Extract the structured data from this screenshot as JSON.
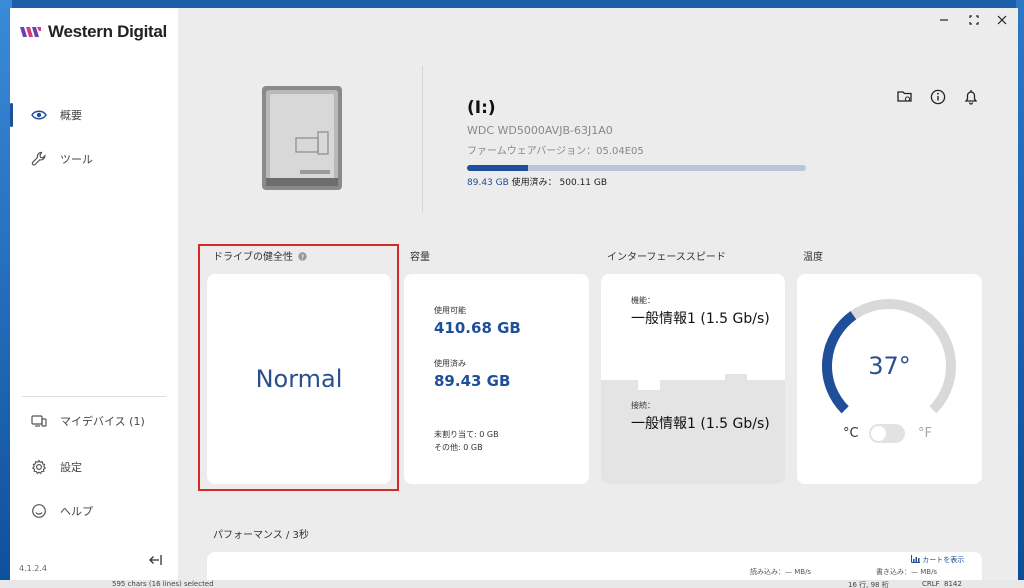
{
  "app": {
    "brand": "Western Digital",
    "version": "4.1.2.4"
  },
  "sidebar": {
    "items": [
      {
        "label": "概要",
        "icon": "eye-icon",
        "active": true
      },
      {
        "label": "ツール",
        "icon": "wrench-icon",
        "active": false
      },
      {
        "label": "マイデバイス (1)",
        "icon": "devices-icon",
        "active": false
      },
      {
        "label": "設定",
        "icon": "gear-icon",
        "active": false
      },
      {
        "label": "ヘルプ",
        "icon": "help-icon",
        "active": false
      }
    ]
  },
  "drive": {
    "title": "(I:)",
    "model": "WDC WD5000AVJB-63J1A0",
    "firmware": "ファームウェアバージョン：05.04E05",
    "used_value": "89.43 GB",
    "used_text": "使用済み：",
    "total": "500.11 GB",
    "used_fraction": 0.179
  },
  "sections": {
    "health": "ドライブの健全性",
    "capacity": "容量",
    "interface": "インターフェーススピード",
    "temperature": "温度",
    "performance": "パフォーマンス / 3秒"
  },
  "health": {
    "value": "Normal"
  },
  "capacity": {
    "available_label": "使用可能",
    "available_value": "410.68 GB",
    "used_label": "使用済み",
    "used_value": "89.43 GB",
    "unallocated": "未割り当て: 0 GB",
    "other": "その他: 0 GB"
  },
  "interface": {
    "capability_label": "機能：",
    "capability_value": "一般情報1 (1.5 Gb/s)",
    "connection_label": "接続：",
    "connection_value": "一般情報1 (1.5 Gb/s)"
  },
  "temperature": {
    "value": "37°",
    "celsius": "°C",
    "fahrenheit": "°F",
    "level_fraction": 0.37
  },
  "performance": {
    "chart_toggle": "カートを表示",
    "read_label": "読み込み：— MB/s",
    "write_label": "書き込み：— MB/s"
  },
  "taskbar": {
    "status_left": "595 chars (16 lines) selected",
    "status_pos": "16 行, 98 桁",
    "status_eol": "CRLF",
    "status_num": "8142"
  },
  "colors": {
    "accent": "#1f4e9a",
    "highlight_frame": "#d52a2a",
    "gauge_track": "#d9d9d9"
  }
}
